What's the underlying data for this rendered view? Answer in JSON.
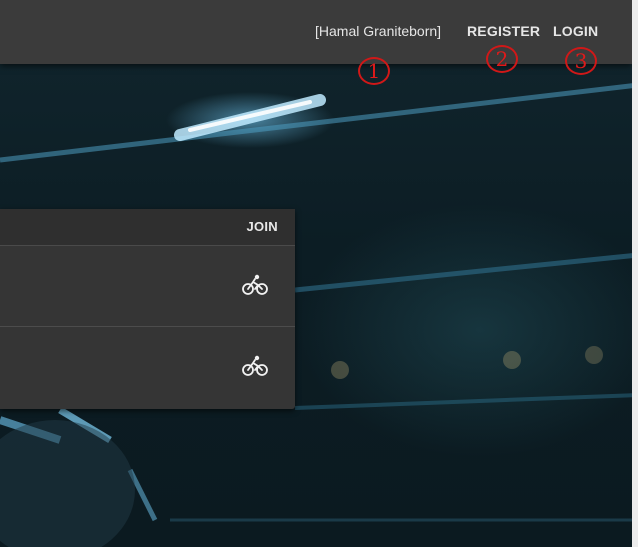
{
  "topbar": {
    "username": "[Hamal Graniteborn]",
    "register_label": "REGISTER",
    "login_label": "LOGIN"
  },
  "markers": [
    "1",
    "2",
    "3"
  ],
  "panel": {
    "header_label": "JOIN",
    "rows": [
      {
        "icon": "bicycle-icon"
      },
      {
        "icon": "bicycle-icon"
      }
    ]
  }
}
